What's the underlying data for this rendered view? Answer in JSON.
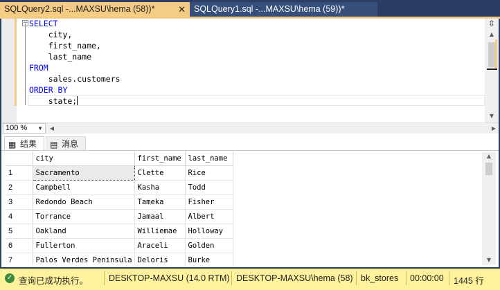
{
  "tabs": [
    {
      "label": "SQLQuery2.sql -...MAXSU\\hema (58))*",
      "close": "✕"
    },
    {
      "label": "SQLQuery1.sql -...MAXSU\\hema (59))*"
    }
  ],
  "editor": {
    "lines": [
      {
        "kw": "SELECT",
        "text": ""
      },
      {
        "kw": "",
        "text": "    city,"
      },
      {
        "kw": "",
        "text": "    first_name,"
      },
      {
        "kw": "",
        "text": "    last_name"
      },
      {
        "kw": "FROM",
        "text": ""
      },
      {
        "kw": "",
        "text": "    sales.customers"
      },
      {
        "kw": "ORDER BY",
        "text": ""
      },
      {
        "kw": "",
        "text": "    state;"
      }
    ],
    "fold_symbol": "−"
  },
  "zoom": {
    "value": "100 %"
  },
  "results_tabs": {
    "results": "结果",
    "messages": "消息"
  },
  "grid": {
    "columns": [
      "city",
      "first_name",
      "last_name"
    ],
    "rows": [
      {
        "num": "1",
        "city": "Sacramento",
        "first_name": "Clette",
        "last_name": "Rice"
      },
      {
        "num": "2",
        "city": "Campbell",
        "first_name": "Kasha",
        "last_name": "Todd"
      },
      {
        "num": "3",
        "city": "Redondo Beach",
        "first_name": "Tameka",
        "last_name": "Fisher"
      },
      {
        "num": "4",
        "city": "Torrance",
        "first_name": "Jamaal",
        "last_name": "Albert"
      },
      {
        "num": "5",
        "city": "Oakland",
        "first_name": "Williemae",
        "last_name": "Holloway"
      },
      {
        "num": "6",
        "city": "Fullerton",
        "first_name": "Araceli",
        "last_name": "Golden"
      },
      {
        "num": "7",
        "city": "Palos Verdes Peninsula",
        "first_name": "Deloris",
        "last_name": "Burke"
      }
    ]
  },
  "status": {
    "message": "查询已成功执行。",
    "server": "DESKTOP-MAXSU (14.0 RTM)",
    "user": "DESKTOP-MAXSU\\hema (58)",
    "database": "bk_stores",
    "elapsed": "00:00:00",
    "rows": "1445 行"
  },
  "colors": {
    "active_tab": "#f5cc84",
    "status_bar": "#fff29d",
    "keyword": "#0000ff",
    "chrome": "#2b3d63"
  }
}
